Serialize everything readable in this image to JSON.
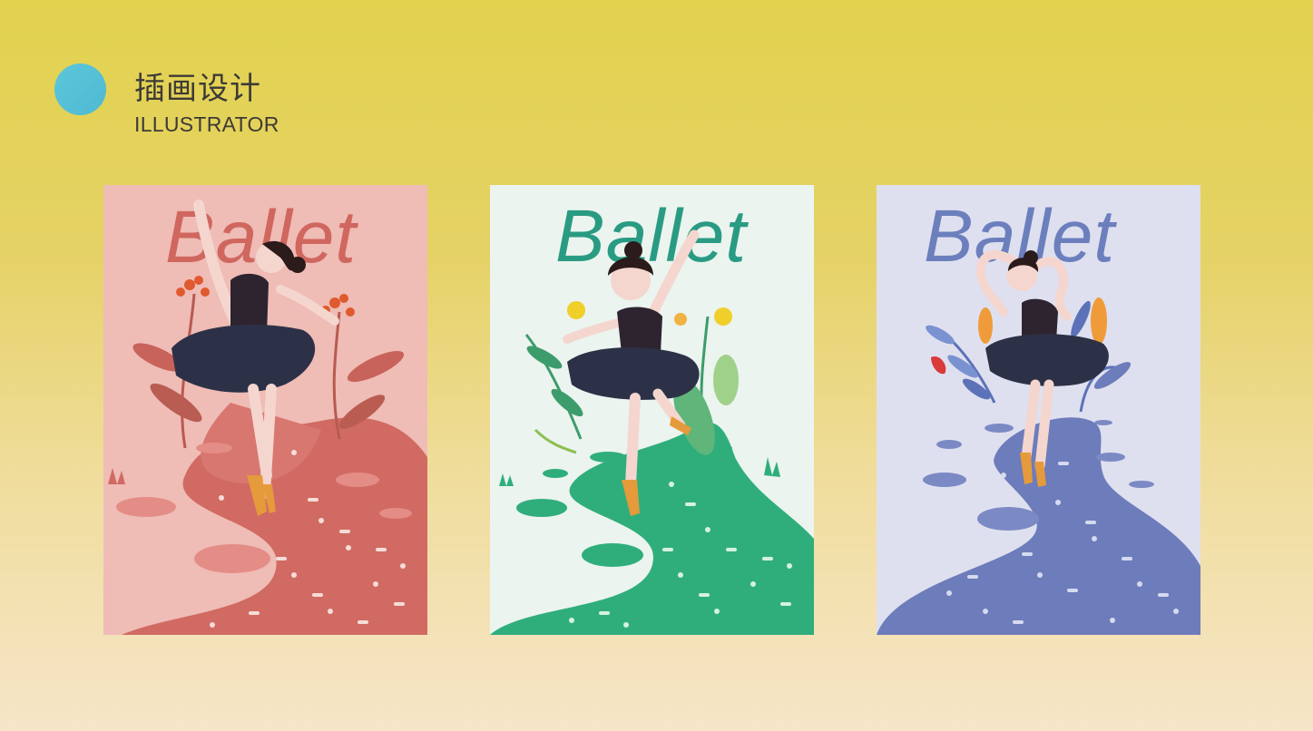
{
  "header": {
    "title_cn": "插画设计",
    "title_en": "ILLUSTRATOR",
    "accent_color": "#54c2d6"
  },
  "posters": [
    {
      "title": "Ballet",
      "background": "#efbcb6",
      "text_color": "#d0675f",
      "path_color": "#d06a62",
      "hole_color": "#e48c86"
    },
    {
      "title": "Ballet",
      "background": "#ebf4ee",
      "text_color": "#2a9b83",
      "path_color": "#2fae7c",
      "hole_color": "#2fae7c"
    },
    {
      "title": "Ballet",
      "background": "#dfe0ef",
      "text_color": "#6c7fbd",
      "path_color": "#6d7cbb",
      "hole_color": "#7b8ac4"
    }
  ],
  "common": {
    "tutu_color": "#2d3147",
    "leotard_color": "#2e2430",
    "hair_color": "#2b1b1b",
    "skin_color": "#f4d6cf",
    "shoe_color": "#e59a3b",
    "icons": [
      "ballerina-figure",
      "flower-plant",
      "star-pattern"
    ]
  }
}
